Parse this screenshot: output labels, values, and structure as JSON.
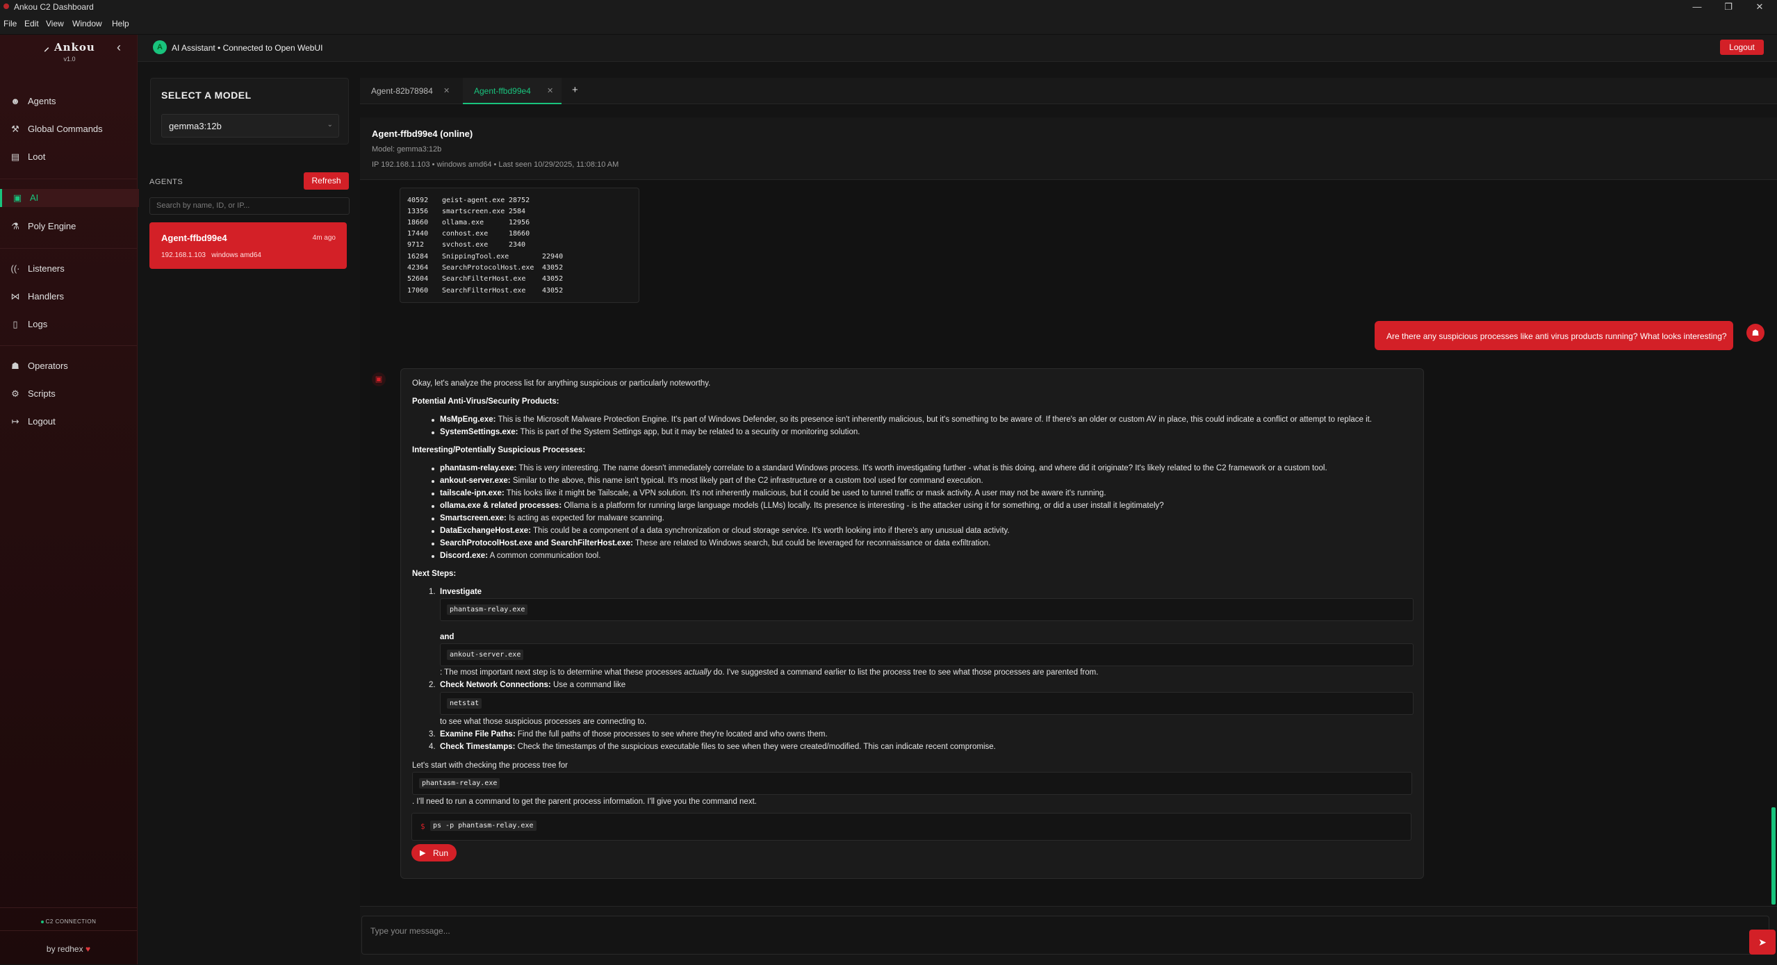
{
  "window": {
    "title": "Ankou C2 Dashboard",
    "minimize": "—",
    "maximize": "❐",
    "close": "✕"
  },
  "menu": [
    "File",
    "Edit",
    "View",
    "Window",
    "Help"
  ],
  "sidebar": {
    "logo": "Ankou",
    "version": "v1.0",
    "items": [
      {
        "label": "Agents",
        "icon": "agents-icon"
      },
      {
        "label": "Global Commands",
        "icon": "globe-icon"
      },
      {
        "label": "Loot",
        "icon": "loot-icon"
      },
      {
        "label": "AI",
        "icon": "ai-icon"
      },
      {
        "label": "Poly Engine",
        "icon": "poly-icon"
      },
      {
        "label": "Listeners",
        "icon": "listeners-icon"
      },
      {
        "label": "Handlers",
        "icon": "handlers-icon"
      },
      {
        "label": "Logs",
        "icon": "logs-icon"
      },
      {
        "label": "Operators",
        "icon": "operators-icon"
      },
      {
        "label": "Scripts",
        "icon": "scripts-icon"
      },
      {
        "label": "Logout",
        "icon": "logout-icon"
      }
    ],
    "active": "AI",
    "connection": "C2 CONNECTION",
    "byline": "by redhex"
  },
  "topbar": {
    "title": "AI Assistant • Connected to Open WebUI",
    "logout": "Logout"
  },
  "model_panel": {
    "heading": "SELECT A MODEL",
    "selected": "gemma3:12b"
  },
  "agents_panel": {
    "heading": "AGENTS",
    "refresh": "Refresh",
    "search_placeholder": "Search by name, ID, or IP...",
    "agent": {
      "name": "Agent-ffbd99e4",
      "time": "4m ago",
      "meta": "192.168.1.103   windows amd64"
    }
  },
  "tabs": [
    {
      "label": "Agent-82b78984",
      "active": false
    },
    {
      "label": "Agent-ffbd99e4",
      "active": true
    }
  ],
  "tab_add": "+",
  "agent_header": {
    "name": "Agent-ffbd99e4 (online)",
    "model": "Model: gemma3:12b",
    "info": "IP 192.168.1.103 • windows amd64 • Last seen 10/29/2025, 11:08:10 AM"
  },
  "process_rows": [
    [
      "40592",
      "geist-agent.exe",
      "28752"
    ],
    [
      "13356",
      "smartscreen.exe",
      "2584"
    ],
    [
      "18660",
      "ollama.exe",
      "12956"
    ],
    [
      "17440",
      "conhost.exe",
      "18660"
    ],
    [
      "9712",
      "svchost.exe",
      "2340"
    ],
    [
      "16284",
      "SnippingTool.exe",
      "22940"
    ],
    [
      "42364",
      "SearchProtocolHost.exe",
      "43052"
    ],
    [
      "52604",
      "SearchFilterHost.exe",
      "43052"
    ],
    [
      "17060",
      "SearchFilterHost.exe",
      "43052"
    ]
  ],
  "user_message": "Are there any suspicious processes like anti virus products running? What looks interesting?",
  "ai": {
    "intro": "Okay, let's analyze the process list for anything suspicious or particularly noteworthy.",
    "av_heading": "Potential Anti-Virus/Security Products:",
    "av_items": [
      {
        "name": "MsMpEng.exe:",
        "text": " This is the Microsoft Malware Protection Engine. It's part of Windows Defender, so its presence isn't inherently malicious, but it's something to be aware of. If there's an older or custom AV in place, this could indicate a conflict or attempt to replace it."
      },
      {
        "name": "SystemSettings.exe:",
        "text": " This is part of the System Settings app, but it may be related to a security or monitoring solution."
      }
    ],
    "int_heading": "Interesting/Potentially Suspicious Processes:",
    "int_items": [
      {
        "name": "phantasm-relay.exe:",
        "pre": " This is ",
        "em": "very",
        "text": " interesting. The name doesn't immediately correlate to a standard Windows process. It's worth investigating further - what is this doing, and where did it originate? It's likely related to the C2 framework or a custom tool."
      },
      {
        "name": "ankout-server.exe:",
        "text": " Similar to the above, this name isn't typical. It's most likely part of the C2 infrastructure or a custom tool used for command execution."
      },
      {
        "name": "tailscale-ipn.exe:",
        "text": " This looks like it might be Tailscale, a VPN solution. It's not inherently malicious, but it could be used to tunnel traffic or mask activity. A user may not be aware it's running."
      },
      {
        "name": "ollama.exe & related processes:",
        "text": " Ollama is a platform for running large language models (LLMs) locally. Its presence is interesting - is the attacker using it for something, or did a user install it legitimately?"
      },
      {
        "name": "Smartscreen.exe:",
        "text": " Is acting as expected for malware scanning."
      },
      {
        "name": "DataExchangeHost.exe:",
        "text": " This could be a component of a data synchronization or cloud storage service. It's worth looking into if there's any unusual data activity."
      },
      {
        "name": "SearchProtocolHost.exe and SearchFilterHost.exe:",
        "text": " These are related to Windows search, but could be leveraged for reconnaissance or data exfiltration."
      },
      {
        "name": "Discord.exe:",
        "text": " A common communication tool."
      }
    ],
    "next_heading": "Next Steps:",
    "step1_num": "1.",
    "step1_title": "Investigate",
    "step1_code1": "phantasm-relay.exe",
    "step1_and": "and",
    "step1_code2": "ankout-server.exe",
    "step1_pre": ": The most important next step is to determine what these processes ",
    "step1_em": "actually",
    "step1_post": " do. I've suggested a command earlier to list the process tree to see what those processes are parented from.",
    "step2_num": "2.",
    "step2_title": "Check Network Connections:",
    "step2_text": " Use a command like",
    "step2_code": "netstat",
    "step2_after": "to see what those suspicious processes are connecting to.",
    "step3_num": "3.",
    "step3_title": "Examine File Paths:",
    "step3_text": " Find the full paths of those processes to see where they're located and who owns them.",
    "step4_num": "4.",
    "step4_title": "Check Timestamps:",
    "step4_text": " Check the timestamps of the suspicious executable files to see when they were created/modified. This can indicate recent compromise.",
    "start_text": "Let's start with checking the process tree for",
    "start_code": "phantasm-relay.exe",
    "end_text": ". I'll need to run a command to get the parent process information. I'll give you the command next.",
    "prompt_symbol": "$",
    "command": "ps -p phantasm-relay.exe",
    "run_label": "Run"
  },
  "input": {
    "placeholder": "Type your message..."
  },
  "colors": {
    "accent_red": "#d32027",
    "accent_green": "#19c37d",
    "sidebar_bg": "#2d1012"
  }
}
